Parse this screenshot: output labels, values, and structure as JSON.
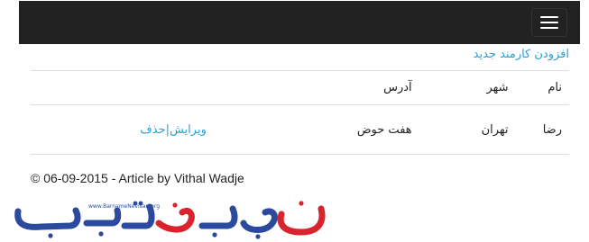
{
  "navbar": {
    "toggle_icon": "hamburger-menu-icon"
  },
  "main": {
    "create_link": "افزودن کارمند جدید",
    "table": {
      "headers": {
        "name": "نام",
        "city": "شهر",
        "address": "آدرس"
      },
      "rows": [
        {
          "name": "رضا",
          "city": "تهران",
          "address": "هفت حوض",
          "edit": "ویرایش",
          "separator": "|",
          "delete": "حذف"
        }
      ]
    }
  },
  "footer": {
    "text": "© 06-09-2015 - Article by Vithal Wadje"
  },
  "logo": {
    "wordmark": "برنامه نویسان",
    "url_text": "www.BarnameNevisan.org",
    "colors": {
      "blue": "#2b4a9e",
      "red": "#d9232d"
    }
  },
  "colors": {
    "navbar": "#222222",
    "link": "#2a9fd6"
  }
}
